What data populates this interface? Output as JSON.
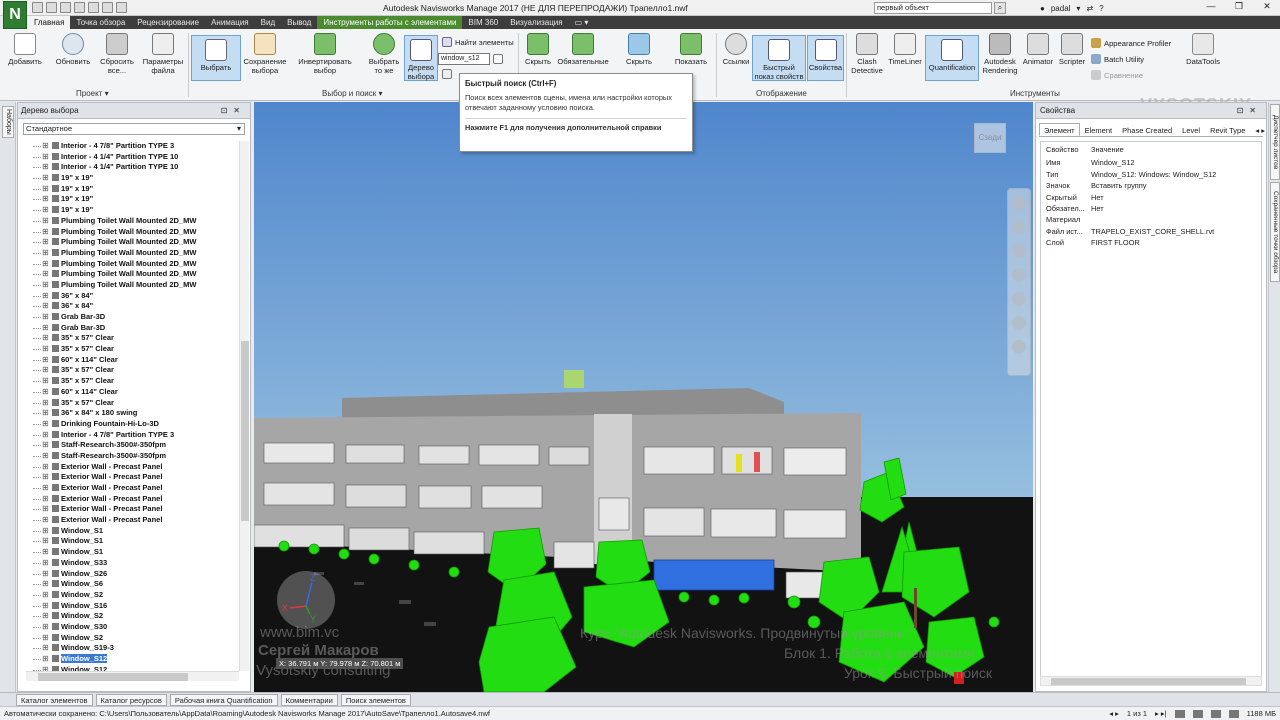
{
  "app": {
    "logo": "N",
    "title": "Autodesk Navisworks Manage 2017 (НЕ ДЛЯ ПЕРЕПРОДАЖИ)   Трапелло1.nwf",
    "search_placeholder": "первый объект",
    "user": "padal"
  },
  "tabs": [
    {
      "label": "Главная",
      "active": true
    },
    {
      "label": "Точка обзора"
    },
    {
      "label": "Рецензирование"
    },
    {
      "label": "Анимация"
    },
    {
      "label": "Вид"
    },
    {
      "label": "Вывод"
    },
    {
      "label": "Инструменты работы с элементами",
      "context": true
    },
    {
      "label": "BIM 360"
    },
    {
      "label": "Визуализация"
    }
  ],
  "ribbon": {
    "project": {
      "label": "Проект",
      "buttons": [
        "Добавить",
        "Обновить",
        "Сбросить все...",
        "Параметры файла"
      ]
    },
    "select": {
      "label": "Выбор и поиск",
      "buttons": [
        "Выбрать",
        "Сохранение выбора",
        "Инвертировать выбор",
        "Выбрать то же",
        "Дерево выбора"
      ],
      "find_items": "Найти элементы",
      "quick_find_value": "window_s12"
    },
    "visibility": {
      "buttons": [
        "Скрыть",
        "Обязательные",
        "Скрыть",
        "Показать"
      ]
    },
    "display": {
      "label": "Отображение",
      "buttons": [
        "Ссылки",
        "Быстрый показ свойств",
        "Свойства"
      ]
    },
    "tools": {
      "label": "Инструменты",
      "buttons": [
        "Clash Detective",
        "TimeLiner",
        "Quantification",
        "Autodesk Rendering",
        "Animator",
        "Scripter"
      ],
      "small": [
        "Appearance Profiler",
        "Batch Utility",
        "Сравнение"
      ],
      "datatools": "DataTools"
    }
  },
  "tooltip": {
    "title": "Быстрый поиск (Ctrl+F)",
    "body": "Поиск всех элементов сцены, имена или настройки которых отвечают заданному условию поиска.",
    "f1": "Нажмите F1 для получения дополнительной справки"
  },
  "left_strip": {
    "tab": "Наборы"
  },
  "tree": {
    "title": "Дерево выбора",
    "mode": "Стандартное",
    "items": [
      "Interior - 4 7/8\" Partition TYPE 3",
      "Interior - 4 1/4\" Partition TYPE 10",
      "Interior - 4 1/4\" Partition TYPE 10",
      "19\" x 19\"",
      "19\" x 19\"",
      "19\" x 19\"",
      "19\" x 19\"",
      "Plumbing Toilet Wall Mounted 2D_MW",
      "Plumbing Toilet Wall Mounted 2D_MW",
      "Plumbing Toilet Wall Mounted 2D_MW",
      "Plumbing Toilet Wall Mounted 2D_MW",
      "Plumbing Toilet Wall Mounted 2D_MW",
      "Plumbing Toilet Wall Mounted 2D_MW",
      "Plumbing Toilet Wall Mounted 2D_MW",
      "36\" x 84\"",
      "36\" x 84\"",
      "Grab Bar-3D",
      "Grab Bar-3D",
      "35\" x 57\" Clear",
      "35\" x 57\" Clear",
      "60\" x 114\" Clear",
      "35\" x 57\" Clear",
      "35\" x 57\" Clear",
      "60\" x 114\" Clear",
      "35\" x 57\" Clear",
      "36\" x 84\" x 180 swing",
      "Drinking Fountain-Hi-Lo-3D",
      "Interior - 4 7/8\" Partition TYPE 3",
      "Staff-Research-3500#-350fpm",
      "Staff-Research-3500#-350fpm",
      "Exterior Wall - Precast Panel",
      "Exterior Wall - Precast Panel",
      "Exterior Wall - Precast Panel",
      "Exterior Wall - Precast Panel",
      "Exterior Wall - Precast Panel",
      "Exterior Wall - Precast Panel",
      "Window_S1",
      "Window_S1",
      "Window_S1",
      "Window_S33",
      "Window_S26",
      "Window_S6",
      "Window_S2",
      "Window_S16",
      "Window_S2",
      "Window_S30",
      "Window_S2",
      "Window_S19-3",
      "Window_S12",
      "Window_S12"
    ],
    "selected_index": 48
  },
  "viewport": {
    "coords": "X: 36.791 м  Y: 79.978 м  Z: 70.801 м",
    "viewcube": "Сзади",
    "watermark_url": "www.bim.vc",
    "watermark_author": "Сергей Макаров",
    "watermark_company": "Vysotskiy consulting",
    "watermark_course": "Курс \"Autodesk Navisworks. Продвинутый уровень\"",
    "watermark_block": "Блок 1. Работа с элементами",
    "watermark_lesson": "Урок 5. Быстрый поиск",
    "brand": "VYSOTSKIY"
  },
  "right_strip": {
    "tabs": [
      "Диспетчер листов",
      "Сохраненные точки обзора"
    ]
  },
  "properties": {
    "title": "Свойства",
    "tabs": [
      "Элемент",
      "Element",
      "Phase Created",
      "Level",
      "Revit Type"
    ],
    "header": {
      "k": "Свойство",
      "v": "Значение"
    },
    "rows": [
      {
        "k": "Имя",
        "v": "Window_S12"
      },
      {
        "k": "Тип",
        "v": "Window_S12: Windows: Window_S12"
      },
      {
        "k": "Значок",
        "v": "Вставить группу"
      },
      {
        "k": "Скрытый",
        "v": "Нет"
      },
      {
        "k": "Обязател...",
        "v": "Нет"
      },
      {
        "k": "Материал",
        "v": ""
      },
      {
        "k": "Файл ист...",
        "v": "TRAPELO_EXIST_CORE_SHELL.rvt"
      },
      {
        "k": "Слой",
        "v": "FIRST FLOOR"
      }
    ]
  },
  "bottom_tabs": [
    "Каталог элементов",
    "Каталог ресурсов",
    "Рабочая книга Quantification",
    "Комментарии",
    "Поиск элементов"
  ],
  "status": {
    "text": "Автоматически сохранено: C:\\Users\\Пользователь\\AppData\\Roaming\\Autodesk Navisworks Manage 2017\\AutoSave\\Трапелло1.Autosave4.nwf",
    "page": "1 из 1",
    "memory": "1188 МБ"
  },
  "colors": {
    "context_tab": "#4b8a2f",
    "sky_top": "#4f86cc",
    "sky_bottom": "#b9dbe8",
    "building": "#a8a8a8",
    "tree_green": "#22dd11",
    "ground": "#121212",
    "selection": "#3a78d6"
  }
}
